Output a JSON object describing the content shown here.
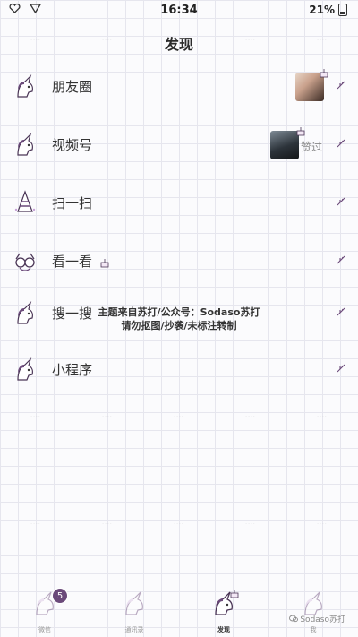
{
  "status_bar": {
    "time": "16:34",
    "battery": "21%"
  },
  "header": {
    "title": "发现"
  },
  "menu": [
    {
      "label": "朋友圈"
    },
    {
      "label": "视频号",
      "status": "赞过"
    },
    {
      "label": "扫一扫"
    },
    {
      "label": "看一看"
    },
    {
      "label": "搜一搜"
    },
    {
      "label": "小程序"
    }
  ],
  "overlay": {
    "line1": "主题来自苏打/公众号：Sodaso苏打",
    "line2": "请勿抠图/抄袭/未标注转制"
  },
  "tab_bar": {
    "tabs": [
      {
        "label": "微信",
        "badge": "5"
      },
      {
        "label": "通讯录"
      },
      {
        "label": "发现"
      },
      {
        "label": "我"
      }
    ],
    "credit": "Sodaso苏打"
  },
  "colors": {
    "accent": "#6b4a7a",
    "grid": "#e6e6ee",
    "background": "#fbfbfd"
  }
}
